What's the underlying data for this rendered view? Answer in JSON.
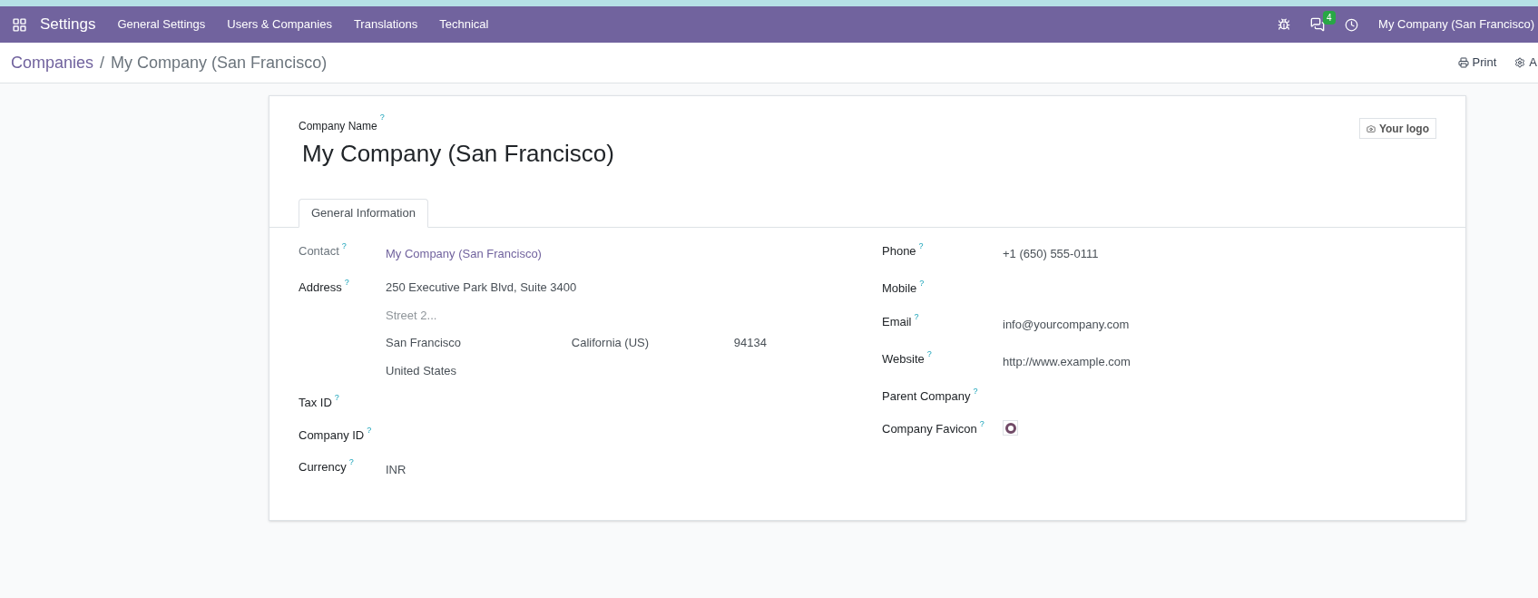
{
  "navbar": {
    "app_name": "Settings",
    "menu": [
      "General Settings",
      "Users & Companies",
      "Translations",
      "Technical"
    ],
    "messages_count": "4",
    "company": "My Company (San Francisco)"
  },
  "breadcrumb": {
    "parent": "Companies",
    "separator": "/",
    "current": "My Company (San Francisco)"
  },
  "actions": [
    {
      "kind": "print",
      "label": "Print"
    },
    {
      "kind": "gear",
      "label": "A"
    }
  ],
  "form": {
    "name_label": "Company Name",
    "name_help": "?",
    "name": "My Company (San Francisco)",
    "logo_button": "Your logo",
    "tabs": [
      {
        "label": "General Information",
        "selected": true
      }
    ],
    "left_fields": [
      {
        "label": "Contact",
        "help": "?",
        "kind": "link",
        "muted_label": true,
        "value": "My Company (San Francisco)"
      },
      {
        "label": "Address",
        "help": "?",
        "kind": "address",
        "muted_label": false,
        "street": "250 Executive Park Blvd, Suite 3400",
        "street2_placeholder": "Street 2...",
        "city": "San Francisco",
        "state": "California (US)",
        "zip": "94134",
        "country": "United States"
      },
      {
        "label": "Tax ID",
        "help": "?",
        "kind": "empty",
        "muted_label": false
      },
      {
        "label": "Company ID",
        "help": "?",
        "kind": "empty",
        "muted_label": false
      },
      {
        "label": "Currency",
        "help": "?",
        "kind": "text",
        "muted_label": false,
        "value": "INR"
      }
    ],
    "right_fields": [
      {
        "label": "Phone",
        "help": "?",
        "kind": "text",
        "value": "+1 (650) 555-0111"
      },
      {
        "label": "Mobile",
        "help": "?",
        "kind": "empty"
      },
      {
        "label": "Email",
        "help": "?",
        "kind": "text",
        "value": "info@yourcompany.com"
      },
      {
        "label": "Website",
        "help": "?",
        "kind": "text",
        "value": "http://www.example.com"
      },
      {
        "label": "Parent Company",
        "help": "?",
        "kind": "empty"
      },
      {
        "label": "Company Favicon",
        "help": "?",
        "kind": "favicon"
      }
    ]
  }
}
